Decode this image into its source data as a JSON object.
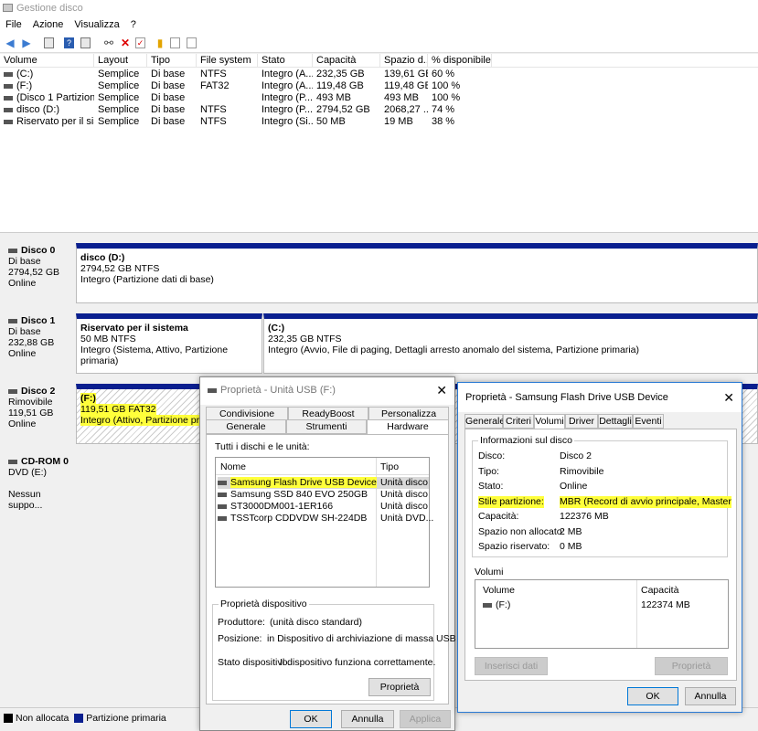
{
  "window": {
    "title": "Gestione disco"
  },
  "menu": [
    "File",
    "Azione",
    "Visualizza",
    "?"
  ],
  "toolbar_icons": [
    "back-icon",
    "forward-icon",
    "properties-icon",
    "help-icon",
    "help-topic-icon",
    "connect-icon",
    "delete-icon",
    "check-icon",
    "rescan-icon",
    "new-icon",
    "list-icon"
  ],
  "volume_table": {
    "headers": [
      "Volume",
      "Layout",
      "Tipo",
      "File system",
      "Stato",
      "Capacità",
      "Spazio d...",
      "% disponibile"
    ],
    "rows": [
      [
        "(C:)",
        "Semplice",
        "Di base",
        "NTFS",
        "Integro (A...",
        "232,35 GB",
        "139,61 GB",
        "60 %"
      ],
      [
        "(F:)",
        "Semplice",
        "Di base",
        "FAT32",
        "Integro (A...",
        "119,48 GB",
        "119,48 GB",
        "100 %"
      ],
      [
        "(Disco 1 Partizione...",
        "Semplice",
        "Di base",
        "",
        "Integro (P...",
        "493 MB",
        "493 MB",
        "100 %"
      ],
      [
        "disco (D:)",
        "Semplice",
        "Di base",
        "NTFS",
        "Integro (P...",
        "2794,52 GB",
        "2068,27 ...",
        "74 %"
      ],
      [
        "Riservato per il sist...",
        "Semplice",
        "Di base",
        "NTFS",
        "Integro (Si...",
        "50 MB",
        "19 MB",
        "38 %"
      ]
    ]
  },
  "disks": [
    {
      "name": "Disco 0",
      "type": "Di base",
      "size": "2794,52 GB",
      "status": "Online",
      "partitions": [
        {
          "title": "disco  (D:)",
          "size": "2794,52 GB NTFS",
          "status": "Integro (Partizione dati di base)"
        }
      ]
    },
    {
      "name": "Disco 1",
      "type": "Di base",
      "size": "232,88 GB",
      "status": "Online",
      "partitions": [
        {
          "title": "Riservato per il sistema",
          "size": "50 MB NTFS",
          "status": "Integro (Sistema, Attivo, Partizione primaria)"
        },
        {
          "title": "(C:)",
          "size": "232,35 GB NTFS",
          "status": "Integro (Avvio, File di paging, Dettagli arresto anomalo del sistema, Partizione primaria)"
        }
      ]
    },
    {
      "name": "Disco 2",
      "type": "Rimovibile",
      "size": "119,51 GB",
      "status": "Online",
      "partitions": [
        {
          "title": "(F:)",
          "size": "119,51 GB FAT32",
          "status": "Integro (Attivo, Partizione prim"
        }
      ]
    },
    {
      "name": "CD-ROM 0",
      "type": "DVD (E:)",
      "size": "",
      "status": "Nessun suppo..."
    }
  ],
  "legend": [
    {
      "label": "Non allocata",
      "color": "#000000"
    },
    {
      "label": "Partizione primaria",
      "color": "#0a1f8f"
    }
  ],
  "dialog1": {
    "title": "Proprietà - Unità USB (F:)",
    "tabs_back": [
      "Condivisione",
      "ReadyBoost",
      "Personalizza"
    ],
    "tabs_front": [
      "Generale",
      "Strumenti",
      "Hardware"
    ],
    "all_disks_label": "Tutti i dischi e le unità:",
    "list_headers": [
      "Nome",
      "Tipo"
    ],
    "devices": [
      {
        "name": "Samsung Flash Drive USB Device",
        "type": "Unità disco"
      },
      {
        "name": "Samsung SSD 840 EVO 250GB",
        "type": "Unità disco"
      },
      {
        "name": "ST3000DM001-1ER166",
        "type": "Unità disco"
      },
      {
        "name": "TSSTcorp CDDVDW SH-224DB",
        "type": "Unità DVD..."
      }
    ],
    "device_props_title": "Proprietà dispositivo",
    "manufacturer_label": "Produttore:",
    "manufacturer": "(unità disco standard)",
    "location_label": "Posizione:",
    "location": "in Dispositivo di archiviazione di massa USB",
    "status_label": "Stato dispositivo:",
    "status": "Il dispositivo funziona correttamente.",
    "props_button": "Proprietà",
    "ok": "OK",
    "cancel": "Annulla",
    "apply": "Applica"
  },
  "dialog2": {
    "title": "Proprietà - Samsung Flash Drive USB Device",
    "tabs": [
      "Generale",
      "Criteri",
      "Volumi",
      "Driver",
      "Dettagli",
      "Eventi"
    ],
    "info_title": "Informazioni sul disco",
    "fields": [
      {
        "label": "Disco:",
        "value": "Disco 2"
      },
      {
        "label": "Tipo:",
        "value": "Rimovibile"
      },
      {
        "label": "Stato:",
        "value": "Online"
      },
      {
        "label": "Stile partizione:",
        "value": "MBR (Record di avvio principale, Master"
      },
      {
        "label": "Capacità:",
        "value": "122376 MB"
      },
      {
        "label": "Spazio non allocato:",
        "value": "2 MB"
      },
      {
        "label": "Spazio riservato:",
        "value": "0 MB"
      }
    ],
    "volumes_title": "Volumi",
    "vol_headers": [
      "Volume",
      "Capacità"
    ],
    "volumes": [
      {
        "name": "(F:)",
        "capacity": "122374 MB"
      }
    ],
    "populate": "Inserisci dati",
    "props": "Proprietà",
    "ok": "OK",
    "cancel": "Annulla"
  }
}
